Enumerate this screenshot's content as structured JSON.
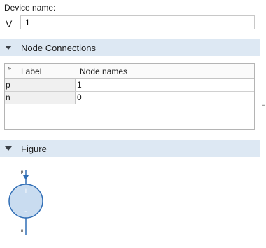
{
  "device": {
    "label": "Device name:",
    "prefix": "V",
    "value": "1"
  },
  "node_connections": {
    "title": "Node Connections",
    "columns": [
      "Label",
      "Node names"
    ],
    "rows": [
      {
        "label": "p",
        "node": "1"
      },
      {
        "label": "n",
        "node": "0"
      }
    ]
  },
  "figure": {
    "title": "Figure",
    "top_terminal": "p",
    "bottom_terminal": "n",
    "plus_sign": "+",
    "minus_sign": "-",
    "source_color": "#c9dcf0",
    "stroke_color": "#2f6db5"
  },
  "icons": {
    "collapse": "triangle-down-icon",
    "table_menu": "double-chevron-right-icon",
    "splitter": "splitter-grip-icon"
  }
}
